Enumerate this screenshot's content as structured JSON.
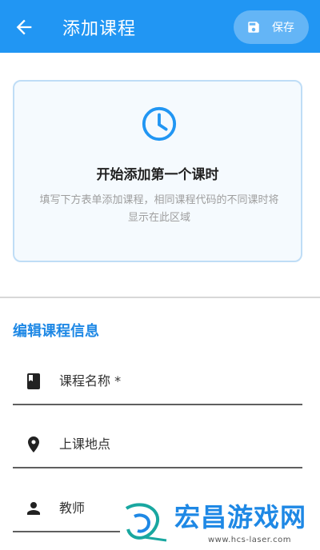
{
  "appbar": {
    "title": "添加课程",
    "save_label": "保存"
  },
  "empty_state": {
    "title": "开始添加第一个课时",
    "description": "填写下方表单添加课程，相同课程代码的不同课时将显示在此区域"
  },
  "form": {
    "section_title": "编辑课程信息",
    "fields": [
      {
        "label": "课程名称 *",
        "icon": "book-icon"
      },
      {
        "label": "上课地点",
        "icon": "location-pin-icon"
      },
      {
        "label": "教师",
        "icon": "person-icon"
      }
    ]
  },
  "watermark": {
    "text": "宏昌游戏网",
    "url": "www.hcs-laser.com"
  },
  "colors": {
    "primary": "#2196F3",
    "accent_text": "#1E88E5",
    "card_border": "#BFDDF6"
  }
}
